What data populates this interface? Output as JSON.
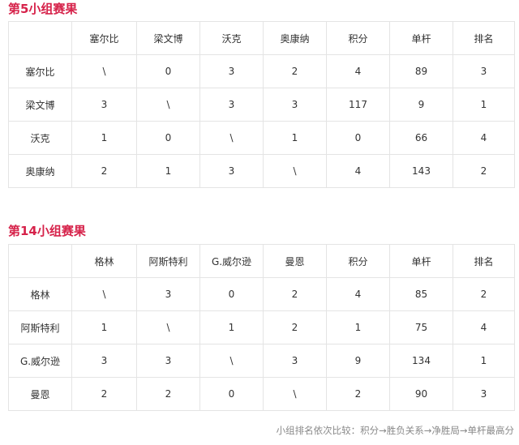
{
  "groups": [
    {
      "title": "第5小组赛果",
      "columns": [
        "",
        "塞尔比",
        "梁文博",
        "沃克",
        "奥康纳",
        "积分",
        "单杆",
        "排名"
      ],
      "rows": [
        [
          "塞尔比",
          "\\",
          "0",
          "3",
          "2",
          "4",
          "89",
          "3"
        ],
        [
          "梁文博",
          "3",
          "\\",
          "3",
          "3",
          "117",
          "9",
          "1"
        ],
        [
          "沃克",
          "1",
          "0",
          "\\",
          "1",
          "0",
          "66",
          "4"
        ],
        [
          "奥康纳",
          "2",
          "1",
          "3",
          "\\",
          "4",
          "143",
          "2"
        ]
      ]
    },
    {
      "title": "第14小组赛果",
      "columns": [
        "",
        "格林",
        "阿斯特利",
        "G.威尔逊",
        "曼恩",
        "积分",
        "单杆",
        "排名"
      ],
      "rows": [
        [
          "格林",
          "\\",
          "3",
          "0",
          "2",
          "4",
          "85",
          "2"
        ],
        [
          "阿斯特利",
          "1",
          "\\",
          "1",
          "2",
          "1",
          "75",
          "4"
        ],
        [
          "G.威尔逊",
          "3",
          "3",
          "\\",
          "3",
          "9",
          "134",
          "1"
        ],
        [
          "曼恩",
          "2",
          "2",
          "0",
          "\\",
          "2",
          "90",
          "3"
        ]
      ]
    }
  ],
  "footnote": "小组排名依次比较：积分→胜负关系→净胜局→单杆最高分"
}
